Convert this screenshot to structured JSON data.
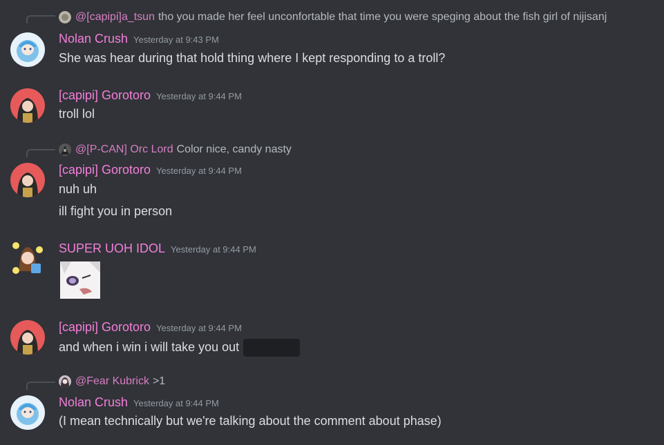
{
  "messages": [
    {
      "reply": {
        "user": "@[capipi]a_tsun",
        "text": "tho you made her feel unconfortable that time you were speging about the fish girl of nijisanj"
      },
      "author": "Nolan Crush",
      "timestamp": "Yesterday at 9:43 PM",
      "lines": [
        "She was hear during that hold thing where I kept responding to a troll?"
      ]
    },
    {
      "author": "[capipi] Gorotoro",
      "timestamp": "Yesterday at 9:44 PM",
      "lines": [
        "troll lol"
      ]
    },
    {
      "reply": {
        "user": "@[P-CAN] Orc Lord",
        "text": "Color nice, candy nasty"
      },
      "author": "[capipi] Gorotoro",
      "timestamp": "Yesterday at 9:44 PM",
      "lines": [
        "nuh uh",
        "ill fight you in person"
      ]
    },
    {
      "author": "SUPER UOH IDOL",
      "timestamp": "Yesterday at 9:44 PM",
      "emoji": "custom-sticker-emoji"
    },
    {
      "author": "[capipi] Gorotoro",
      "timestamp": "Yesterday at 9:44 PM",
      "lines": [
        "and when i win i will take you out"
      ]
    },
    {
      "reply": {
        "user": "@Fear Kubrick",
        "text": ">1"
      },
      "author": "Nolan Crush",
      "timestamp": "Yesterday at 9:44 PM",
      "lines": [
        "(I mean technically but we're talking about the comment about phase)"
      ]
    }
  ],
  "colors": {
    "background": "#313338",
    "username": "#f47fdb",
    "reply_username": "#d77fc4",
    "text": "#dbdee1",
    "timestamp": "#949ba4",
    "spoiler": "#1e1f22"
  }
}
